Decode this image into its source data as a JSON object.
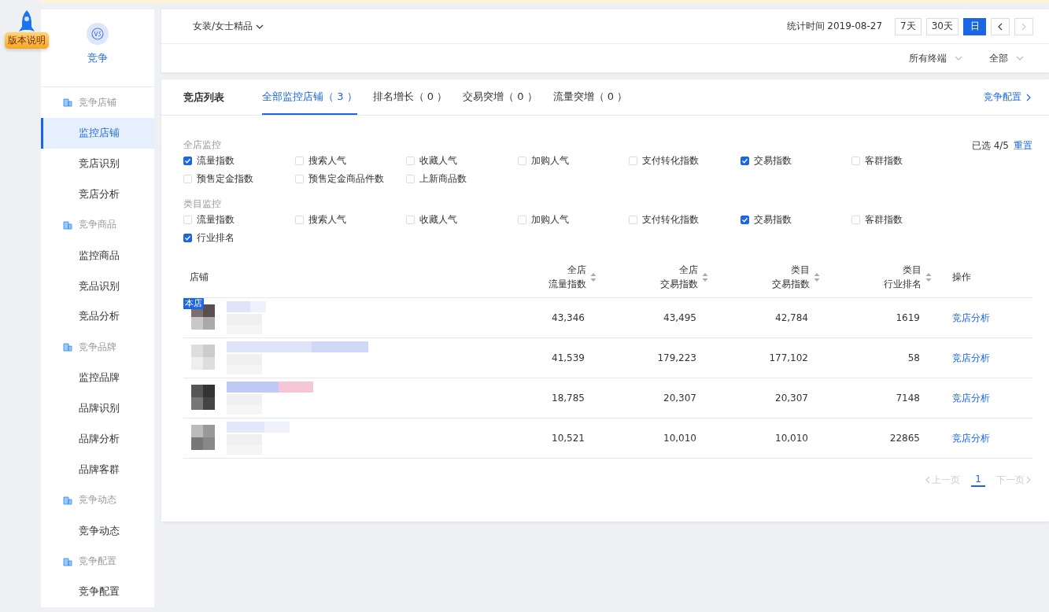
{
  "version_badge": {
    "label": "版本说明"
  },
  "sidebar": {
    "title": "竞争",
    "sections": [
      {
        "heading": "竞争店铺",
        "items": [
          {
            "label": "监控店铺",
            "selected": true
          },
          {
            "label": "竞店识别",
            "selected": false
          },
          {
            "label": "竞店分析",
            "selected": false
          }
        ]
      },
      {
        "heading": "竞争商品",
        "items": [
          {
            "label": "监控商品",
            "selected": false
          },
          {
            "label": "竞品识别",
            "selected": false
          },
          {
            "label": "竞品分析",
            "selected": false
          }
        ]
      },
      {
        "heading": "竞争品牌",
        "items": [
          {
            "label": "监控品牌",
            "selected": false
          },
          {
            "label": "品牌识别",
            "selected": false
          },
          {
            "label": "品牌分析",
            "selected": false
          },
          {
            "label": "品牌客群",
            "selected": false
          }
        ]
      },
      {
        "heading": "竞争动态",
        "items": [
          {
            "label": "竞争动态",
            "selected": false
          }
        ]
      },
      {
        "heading": "竞争配置",
        "items": [
          {
            "label": "竞争配置",
            "selected": false
          }
        ]
      }
    ]
  },
  "header": {
    "category": "女装/女士精品",
    "stat_time": "统计时间 2019-08-27",
    "ranges": [
      {
        "label": "7天",
        "selected": false
      },
      {
        "label": "30天",
        "selected": false
      },
      {
        "label": "日",
        "selected": true
      }
    ],
    "prev_disabled": false,
    "next_disabled": true,
    "filters": [
      "所有终端",
      "全部"
    ]
  },
  "list": {
    "title": "竞店列表",
    "tabs": [
      {
        "label": "全部监控店铺（ 3 ）",
        "selected": true
      },
      {
        "label": "排名增长（ 0 ）",
        "selected": false
      },
      {
        "label": "交易突增（ 0 ）",
        "selected": false
      },
      {
        "label": "流量突增（ 0 ）",
        "selected": false
      }
    ],
    "config_link": "竞争配置",
    "selected_count": "已选 4/5",
    "reset": "重置",
    "groups": [
      {
        "title": "全店监控",
        "options": [
          {
            "label": "流量指数",
            "checked": true
          },
          {
            "label": "搜索人气",
            "checked": false
          },
          {
            "label": "收藏人气",
            "checked": false
          },
          {
            "label": "加购人气",
            "checked": false
          },
          {
            "label": "支付转化指数",
            "checked": false
          },
          {
            "label": "交易指数",
            "checked": true
          },
          {
            "label": "客群指数",
            "checked": false
          },
          {
            "label": "预售定金指数",
            "checked": false
          },
          {
            "label": "预售定金商品件数",
            "checked": false
          },
          {
            "label": "上新商品数",
            "checked": false
          }
        ]
      },
      {
        "title": "类目监控",
        "options": [
          {
            "label": "流量指数",
            "checked": false
          },
          {
            "label": "搜索人气",
            "checked": false
          },
          {
            "label": "收藏人气",
            "checked": false
          },
          {
            "label": "加购人气",
            "checked": false
          },
          {
            "label": "支付转化指数",
            "checked": false
          },
          {
            "label": "交易指数",
            "checked": true
          },
          {
            "label": "客群指数",
            "checked": false
          },
          {
            "label": "行业排名",
            "checked": true
          }
        ]
      }
    ],
    "table": {
      "store_column": "店铺",
      "action_column": "操作",
      "columns": [
        {
          "lines": [
            "全店",
            "流量指数"
          ]
        },
        {
          "lines": [
            "全店",
            "交易指数"
          ]
        },
        {
          "lines": [
            "类目",
            "交易指数"
          ]
        },
        {
          "lines": [
            "类目",
            "行业排名"
          ]
        }
      ],
      "rows": [
        {
          "badge": "本店",
          "values": [
            "43,346",
            "43,495",
            "42,784",
            "1619"
          ],
          "action": "竞店分析"
        },
        {
          "values": [
            "41,539",
            "179,223",
            "177,102",
            "58"
          ],
          "action": "竞店分析"
        },
        {
          "values": [
            "18,785",
            "20,307",
            "20,307",
            "7148"
          ],
          "action": "竞店分析"
        },
        {
          "values": [
            "10,521",
            "10,010",
            "10,010",
            "22865"
          ],
          "action": "竞店分析"
        }
      ]
    },
    "pagination": {
      "prev": "上一页",
      "pages": [
        {
          "label": "1",
          "selected": true
        }
      ],
      "next": "下一页"
    }
  }
}
